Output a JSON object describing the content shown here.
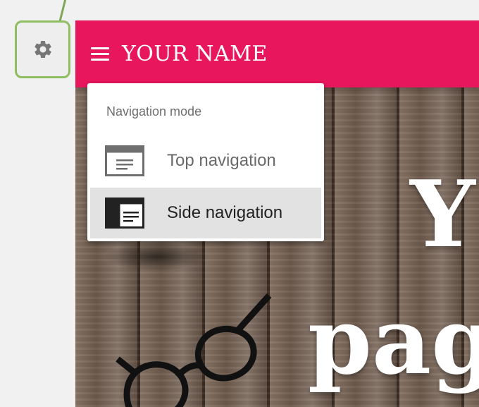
{
  "header": {
    "site_title": "YOUR NAME"
  },
  "hero": {
    "line1": "Y",
    "line2": "pag"
  },
  "navigation_menu": {
    "heading": "Navigation mode",
    "items": [
      {
        "label": "Top navigation",
        "selected": false,
        "icon": "top-navigation-layout-icon"
      },
      {
        "label": "Side navigation",
        "selected": true,
        "icon": "side-navigation-layout-icon"
      }
    ]
  },
  "colors": {
    "appbar": "#e8175d",
    "highlight_border": "#8fbd62",
    "selected_item_bg": "#e2e2e2"
  },
  "icons": {
    "settings": "gear-icon",
    "menu": "hamburger-menu-icon"
  }
}
